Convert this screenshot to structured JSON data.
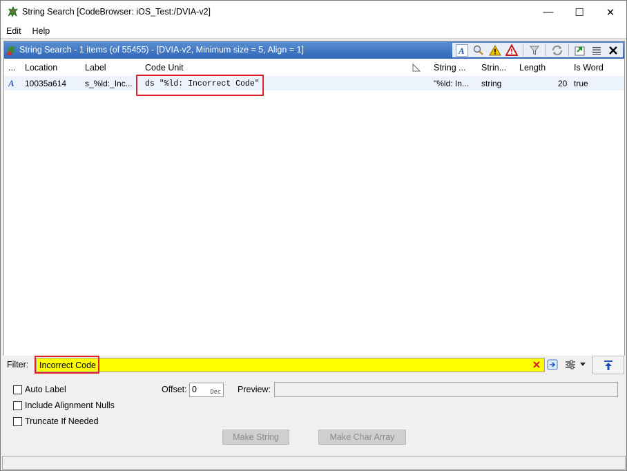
{
  "window": {
    "title": "String Search [CodeBrowser: iOS_Test:/DVIA-v2]",
    "minimize_glyph": "—",
    "maximize_glyph": "☐",
    "close_glyph": "✕"
  },
  "menu": {
    "items": [
      "Edit",
      "Help"
    ]
  },
  "panel": {
    "title": "String Search - 1 items (of 55455) - [DVIA-v2, Minimum size = 5, Align = 1]",
    "toolbar_icons": [
      "font-a-icon",
      "magnifier-icon",
      "warning-icon",
      "error-icon",
      "filter-funnel-icon",
      "refresh-icon",
      "export-icon",
      "menu-icon",
      "close-icon"
    ]
  },
  "table": {
    "columns": [
      "...",
      "Location",
      "Label",
      "Code Unit",
      "String ...",
      "Strin...",
      "Length",
      "Is Word"
    ],
    "rows": [
      {
        "icon": "font-a-icon",
        "location": "10035a614",
        "label": "s_%ld:_Inc...",
        "code_unit": "ds \"%ld: Incorrect Code\"",
        "string": "\"%ld: In...",
        "string_type": "string",
        "length": "20",
        "is_word": "true"
      }
    ]
  },
  "filter": {
    "label": "Filter:",
    "value": "Incorrect Code",
    "highlight_color": "#ffff00"
  },
  "options": {
    "auto_label": "Auto Label",
    "include_alignment_nulls": "Include Alignment Nulls",
    "truncate_if_needed": "Truncate If Needed",
    "offset_label": "Offset:",
    "offset_value": "0",
    "offset_format": "Dec",
    "preview_label": "Preview:",
    "make_string": "Make String",
    "make_char_array": "Make Char Array"
  },
  "colors": {
    "header_blue": "#2f66b8",
    "row_selected": "#ecf3fc",
    "annotation_red": "#e0202a"
  }
}
